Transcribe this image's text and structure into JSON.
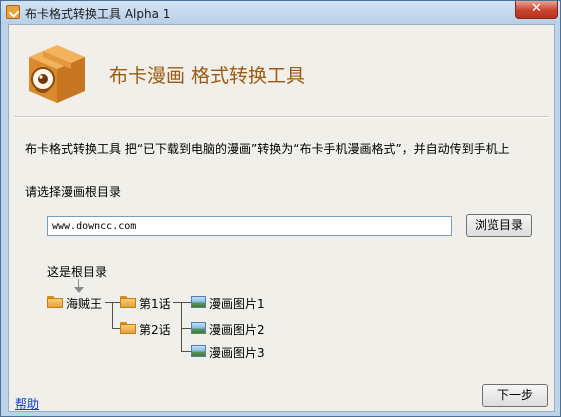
{
  "window": {
    "title": "布卡格式转换工具 Alpha 1",
    "close_label": "✕"
  },
  "header": {
    "title": "布卡漫画 格式转换工具",
    "logo_icon": "box-mascot-icon"
  },
  "description": "布卡格式转换工具 把“已下载到电脑的漫画”转换为“布卡手机漫画格式”，并自动传到手机上",
  "root_select": {
    "label": "请选择漫画根目录",
    "input_value": "www.downcc.com",
    "browse_label": "浏览目录"
  },
  "diagram": {
    "root_label": "这是根目录",
    "root_folder": "海贼王",
    "chapters": [
      "第1话",
      "第2话"
    ],
    "images": [
      "漫画图片1",
      "漫画图片2",
      "漫画图片3"
    ]
  },
  "footer": {
    "help_label": "帮助",
    "next_label": "下一步"
  },
  "colors": {
    "accent": "#9c5a12",
    "link": "#0a3fbf",
    "close": "#c7442c"
  }
}
